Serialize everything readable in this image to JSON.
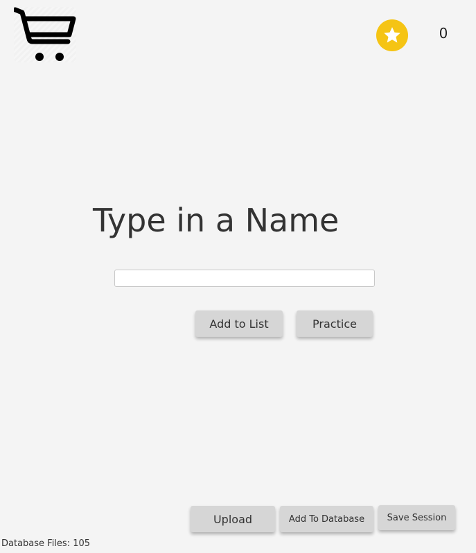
{
  "header": {
    "cart_icon": "shopping-cart-icon",
    "star_icon": "star-icon",
    "star_color": "#f5c414",
    "score": "0"
  },
  "main": {
    "title": "Type in a Name",
    "name_input": {
      "value": "",
      "placeholder": ""
    },
    "add_to_list_label": "Add to List",
    "practice_label": "Practice"
  },
  "footer": {
    "upload_label": "Upload",
    "add_to_database_label": "Add To Database",
    "save_session_label": "Save Session",
    "database_files_text": "Database Files: 105"
  }
}
